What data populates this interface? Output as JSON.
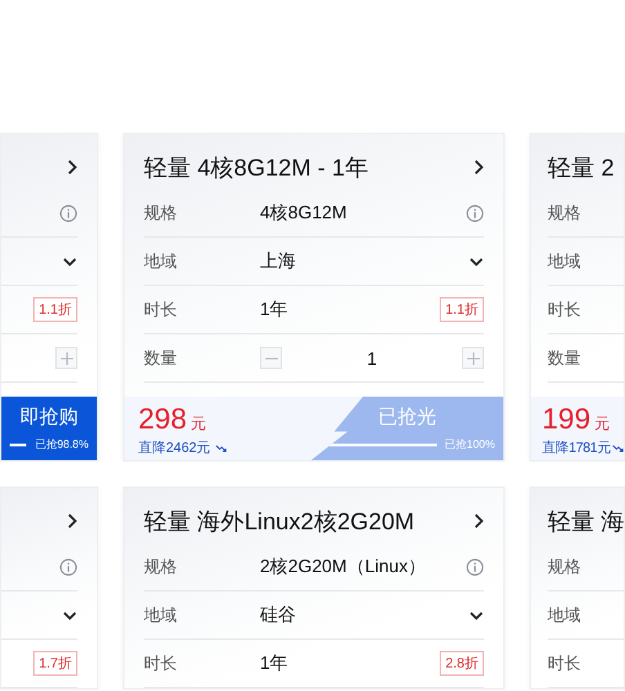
{
  "rows": [
    {
      "cards": [
        {
          "kind": "clipped-left",
          "rows": [
            {
              "kind": "info"
            },
            {
              "kind": "select"
            },
            {
              "kind": "duration",
              "tag": "1.1折"
            },
            {
              "kind": "quantity"
            }
          ],
          "button": {
            "label": "即抢购",
            "sold_out": false,
            "level": 0.988,
            "progress": "已抢98.8%"
          }
        },
        {
          "kind": "full",
          "title": "轻量 4核8G12M - 1年",
          "rows": [
            {
              "kind": "info",
              "label": "规格",
              "value": "4核8G12M"
            },
            {
              "kind": "select",
              "label": "地域",
              "value": "上海"
            },
            {
              "kind": "duration",
              "label": "时长",
              "value": "1年",
              "tag": "1.1折"
            },
            {
              "kind": "quantity",
              "label": "数量",
              "value": "1"
            }
          ],
          "price": "298",
          "unit": "元",
          "drop": "直降2462元",
          "button": {
            "label": "已抢光",
            "sold_out": true,
            "level": 1,
            "progress": "已抢100%"
          }
        },
        {
          "kind": "clipped-right",
          "title": "轻量 2",
          "rows": [
            {
              "label": "规格"
            },
            {
              "label": "地域"
            },
            {
              "label": "时长"
            },
            {
              "label": "数量"
            }
          ],
          "price": "199",
          "unit": "元",
          "drop": "直降1781元"
        }
      ]
    },
    {
      "cards": [
        {
          "kind": "clipped-left",
          "rows": [
            {
              "kind": "info"
            },
            {
              "kind": "select"
            },
            {
              "kind": "duration",
              "tag": "1.7折"
            }
          ]
        },
        {
          "kind": "full",
          "title": "轻量 海外Linux2核2G20M",
          "rows": [
            {
              "kind": "info",
              "label": "规格",
              "value": "2核2G20M（Linux）"
            },
            {
              "kind": "select",
              "label": "地域",
              "value": "硅谷"
            },
            {
              "kind": "duration",
              "label": "时长",
              "value": "1年",
              "tag": "2.8折"
            }
          ]
        },
        {
          "kind": "clipped-right",
          "title": "轻量 海",
          "rows": [
            {
              "label": "规格"
            },
            {
              "label": "地域"
            },
            {
              "label": "时长"
            }
          ]
        }
      ]
    }
  ]
}
